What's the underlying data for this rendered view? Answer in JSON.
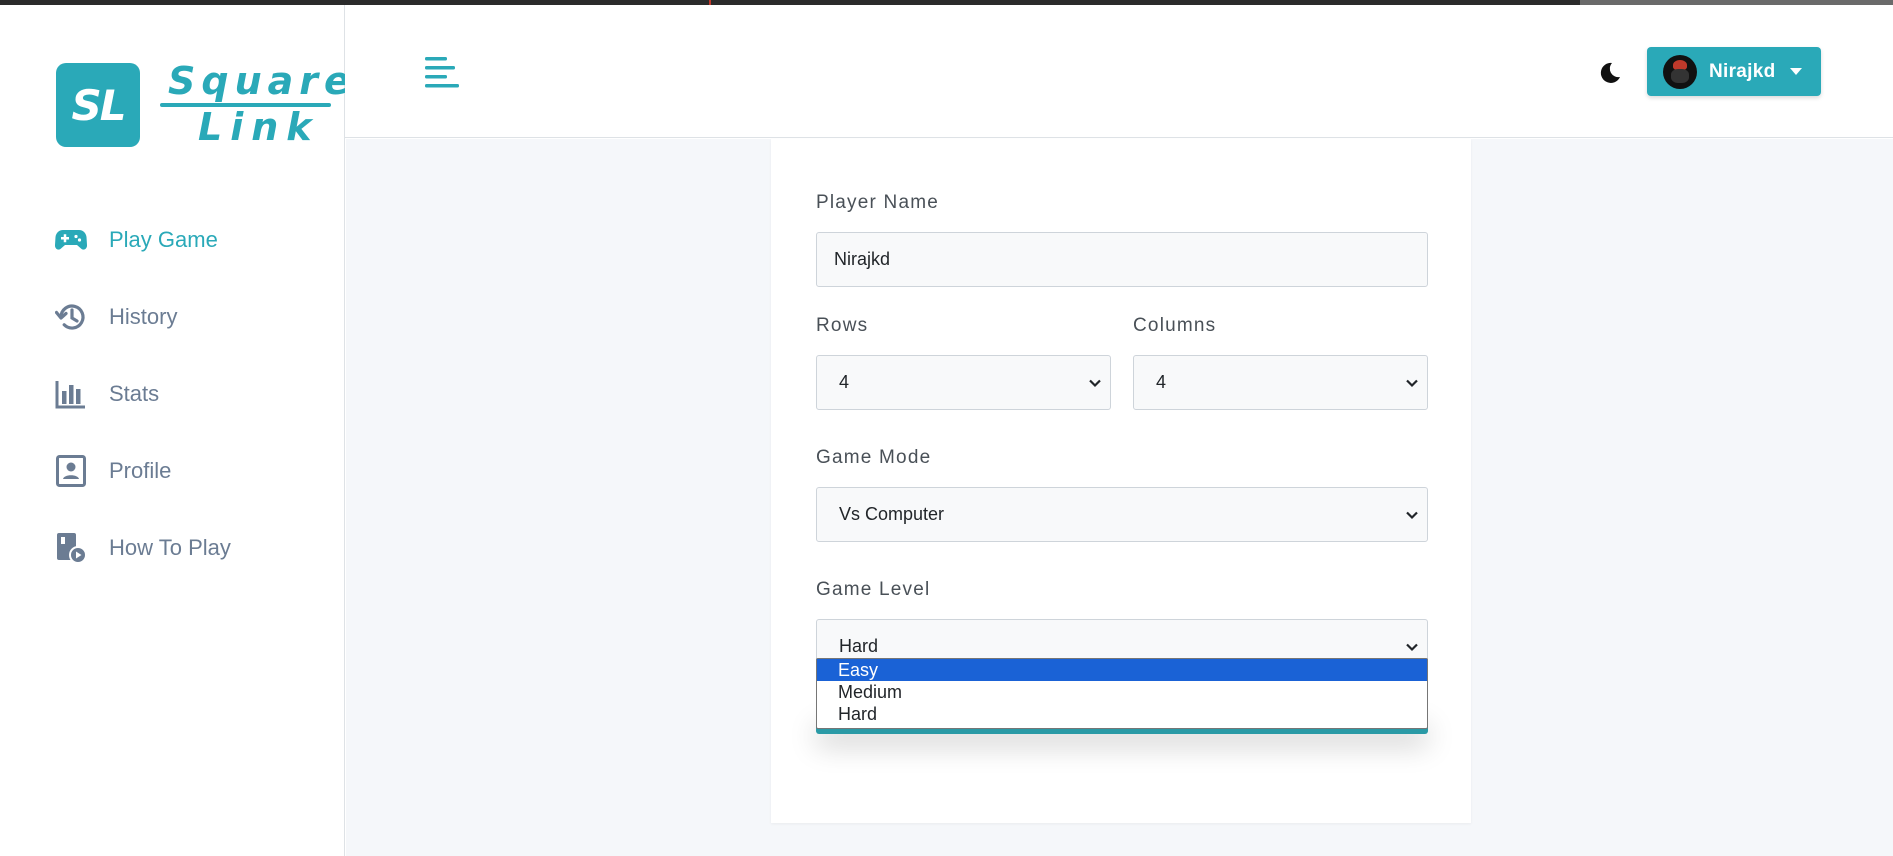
{
  "app": {
    "logo_badge": "SL",
    "logo_word1": "Square",
    "logo_word2": "Link"
  },
  "sidebar": {
    "items": [
      {
        "label": "Play Game",
        "icon": "gamepad-icon",
        "active": true
      },
      {
        "label": "History",
        "icon": "history-icon",
        "active": false
      },
      {
        "label": "Stats",
        "icon": "bar-chart-icon",
        "active": false
      },
      {
        "label": "Profile",
        "icon": "profile-card-icon",
        "active": false
      },
      {
        "label": "How To Play",
        "icon": "video-guide-icon",
        "active": false
      }
    ]
  },
  "header": {
    "user_name": "Nirajkd"
  },
  "form": {
    "player_name_label": "Player Name",
    "player_name_value": "Nirajkd",
    "rows_label": "Rows",
    "rows_value": "4",
    "columns_label": "Columns",
    "columns_value": "4",
    "mode_label": "Game Mode",
    "mode_value": "Vs Computer",
    "level_label": "Game Level",
    "level_value": "Hard",
    "level_options": [
      "Easy",
      "Medium",
      "Hard"
    ],
    "level_highlighted": "Easy"
  },
  "colors": {
    "accent": "#2aa9b8",
    "muted_nav": "#6b7c93",
    "option_highlight": "#1a62d6",
    "main_bg": "#f5f7fa"
  }
}
